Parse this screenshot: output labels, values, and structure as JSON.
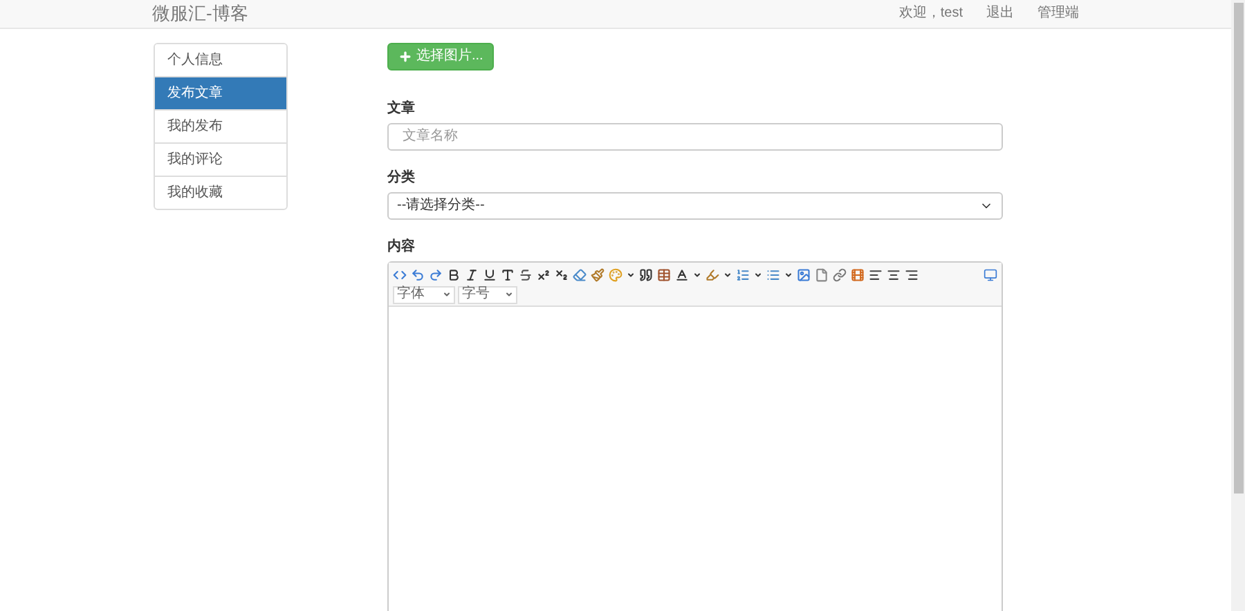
{
  "navbar": {
    "brand": "微服汇-博客",
    "links": [
      "欢迎，test",
      "退出",
      "管理端"
    ]
  },
  "sidebar": {
    "items": [
      {
        "label": "个人信息",
        "selected": false
      },
      {
        "label": "发布文章",
        "selected": true
      },
      {
        "label": "我的发布",
        "selected": false
      },
      {
        "label": "我的评论",
        "selected": false
      },
      {
        "label": "我的收藏",
        "selected": false
      }
    ]
  },
  "form": {
    "upload_button": "选择图片...",
    "title_label": "文章",
    "title_placeholder": "文章名称",
    "category_label": "分类",
    "category_value": "--请选择分类--",
    "content_label": "内容",
    "font_select": "字体",
    "size_select": "字号"
  }
}
